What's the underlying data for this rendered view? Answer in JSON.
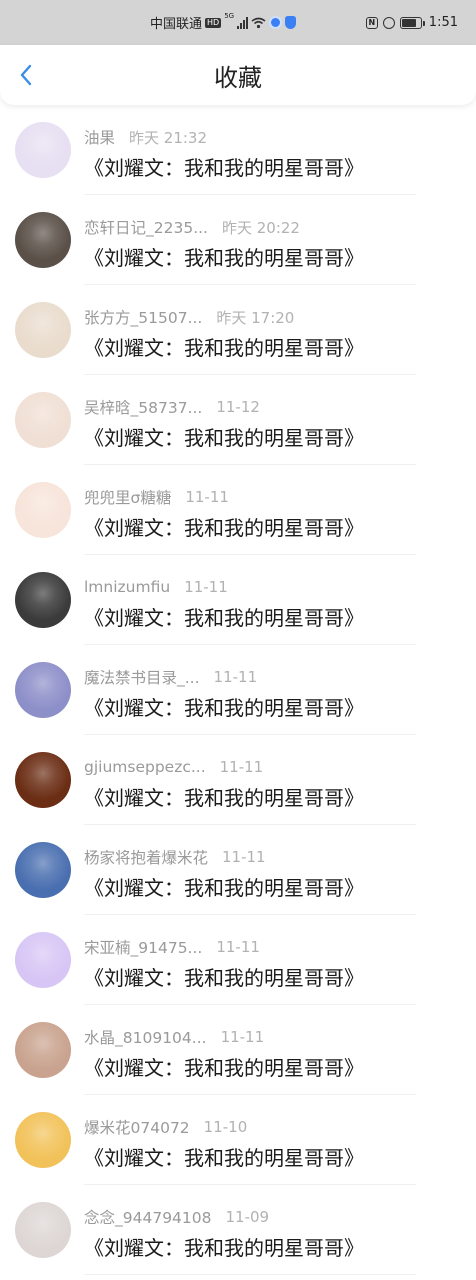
{
  "status_bar": {
    "carrier": "中国联通",
    "hd": "HD",
    "network": "5G",
    "time": "1:51",
    "battery_level": 0.8
  },
  "header": {
    "title": "收藏",
    "back_icon": "back-chevron-icon",
    "accent_color": "#3a8ee6"
  },
  "items": [
    {
      "name": "油果",
      "date": "昨天 21:32",
      "title": "《刘耀文：我和我的明星哥哥》",
      "avatar_color": "#e7dff2"
    },
    {
      "name": "恋轩日记_2235...",
      "date": "昨天 20:22",
      "title": "《刘耀文：我和我的明星哥哥》",
      "avatar_color": "#5a5048"
    },
    {
      "name": "张方方_51507...",
      "date": "昨天 17:20",
      "title": "《刘耀文：我和我的明星哥哥》",
      "avatar_color": "#e9dccd"
    },
    {
      "name": "吴梓晗_58737...",
      "date": "11-12",
      "title": "《刘耀文：我和我的明星哥哥》",
      "avatar_color": "#f0dfd4"
    },
    {
      "name": "兜兜里σ糖糖",
      "date": "11-11",
      "title": "《刘耀文：我和我的明星哥哥》",
      "avatar_color": "#f7e4da"
    },
    {
      "name": "lmnizumfiu",
      "date": "11-11",
      "title": "《刘耀文：我和我的明星哥哥》",
      "avatar_color": "#3b3b3b"
    },
    {
      "name": "魔法禁书目录_...",
      "date": "11-11",
      "title": "《刘耀文：我和我的明星哥哥》",
      "avatar_color": "#8d8fc9"
    },
    {
      "name": "gjiumseppezc...",
      "date": "11-11",
      "title": "《刘耀文：我和我的明星哥哥》",
      "avatar_color": "#6b2d14"
    },
    {
      "name": "杨家将抱着爆米花",
      "date": "11-11",
      "title": "《刘耀文：我和我的明星哥哥》",
      "avatar_color": "#4a6fb0"
    },
    {
      "name": "宋亚楠_91475...",
      "date": "11-11",
      "title": "《刘耀文：我和我的明星哥哥》",
      "avatar_color": "#d7c6f5"
    },
    {
      "name": "水晶_8109104...",
      "date": "11-11",
      "title": "《刘耀文：我和我的明星哥哥》",
      "avatar_color": "#c9a38f"
    },
    {
      "name": "爆米花074072",
      "date": "11-10",
      "title": "《刘耀文：我和我的明星哥哥》",
      "avatar_color": "#f2c25a"
    },
    {
      "name": "念念_944794108",
      "date": "11-09",
      "title": "《刘耀文：我和我的明星哥哥》",
      "avatar_color": "#ddd6d4"
    }
  ]
}
